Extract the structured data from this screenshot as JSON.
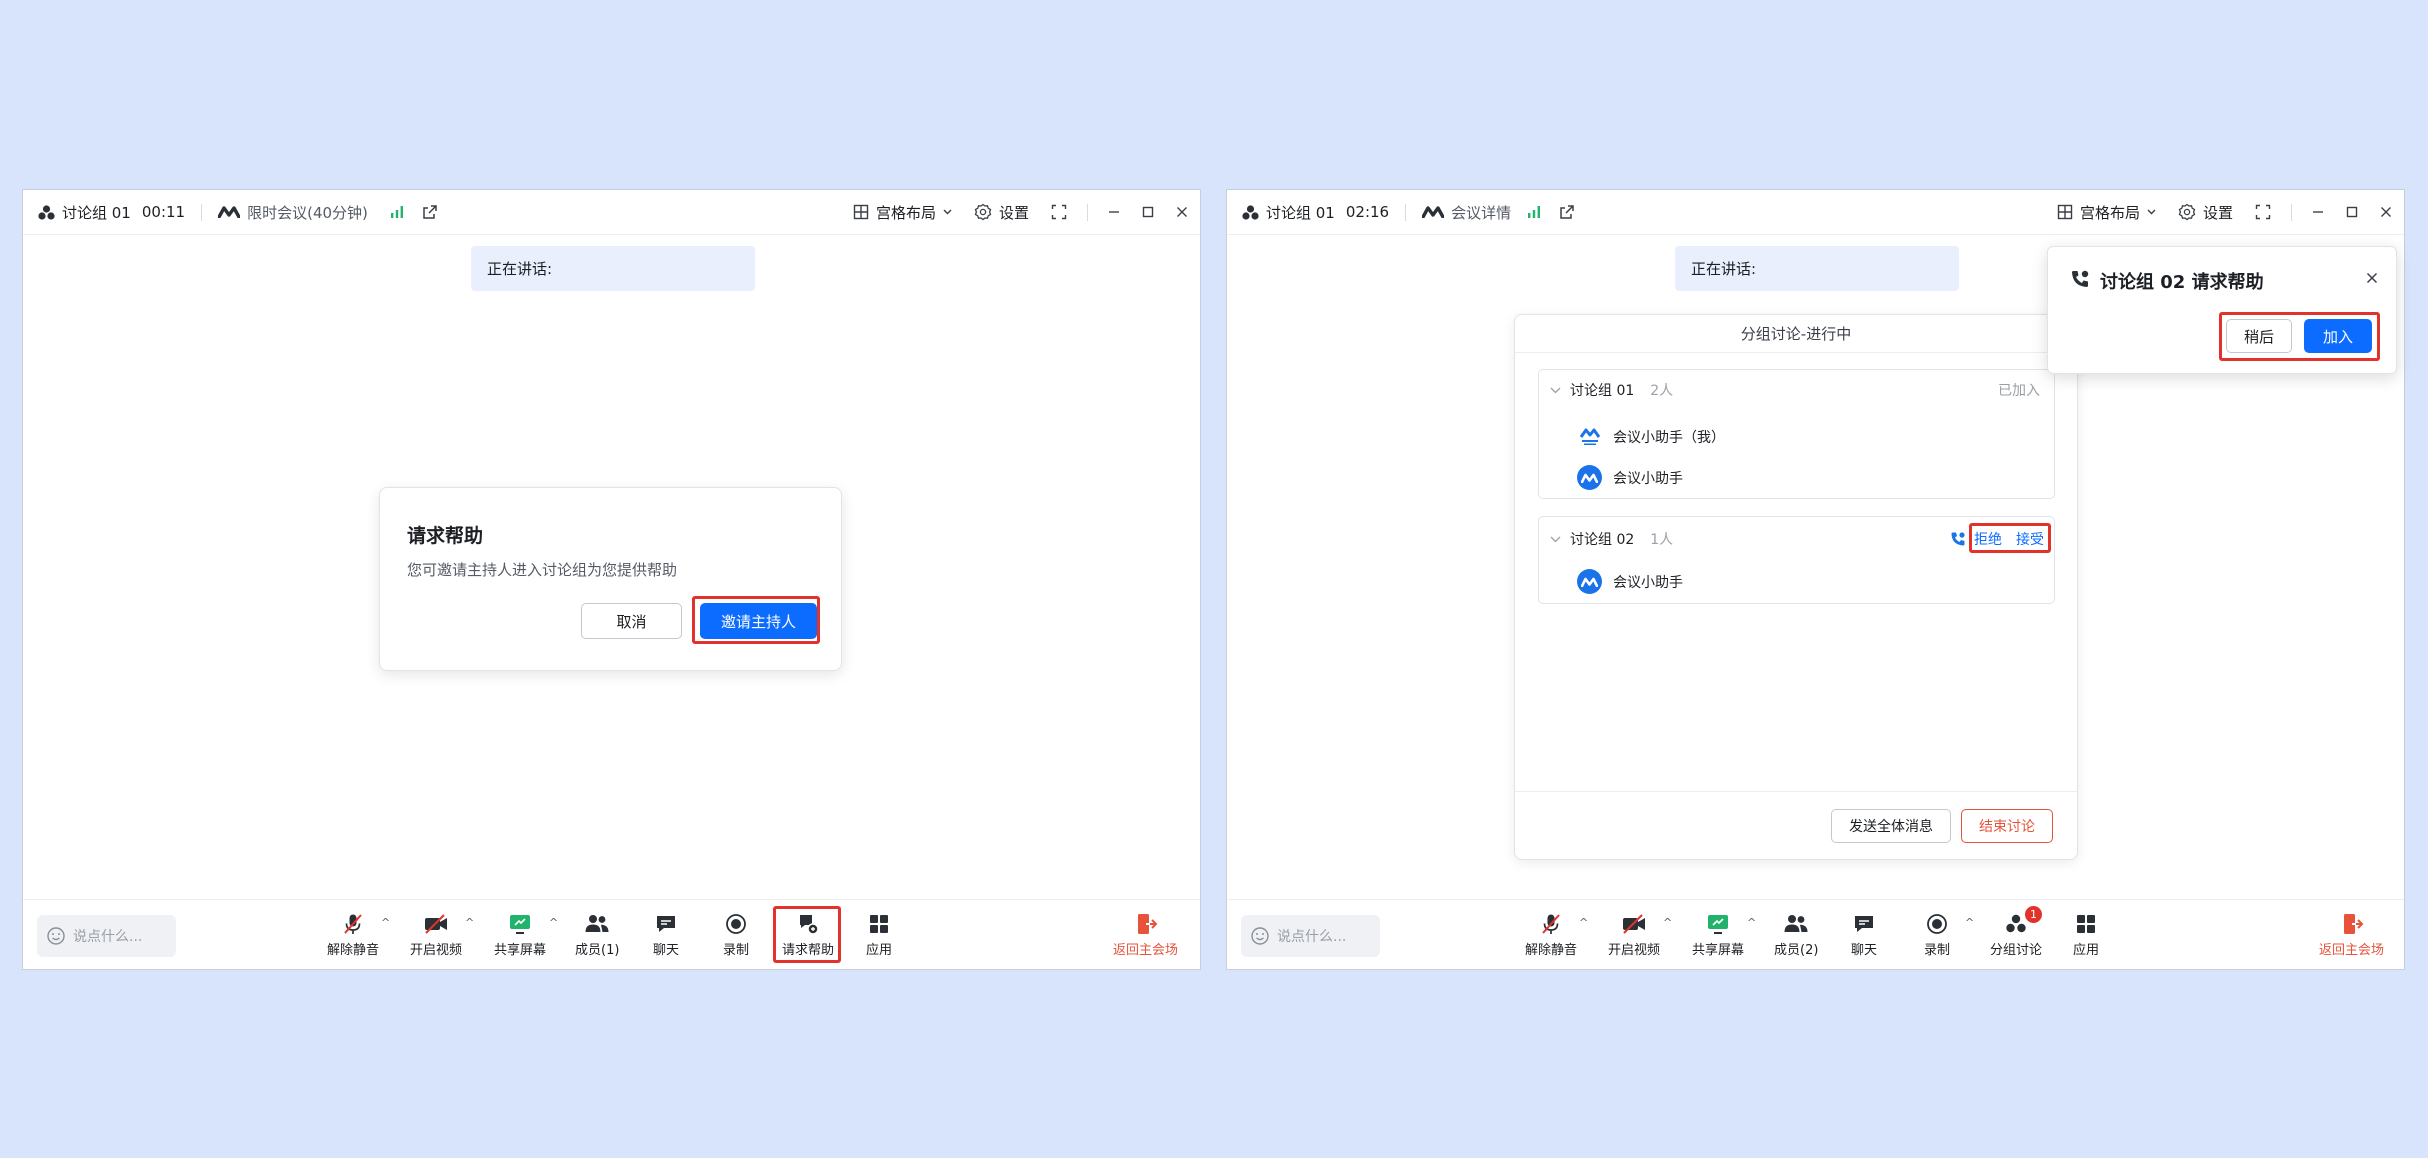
{
  "left_window": {
    "titlebar": {
      "group_name": "讨论组 01",
      "timer": "00:11",
      "meeting_info": "限时会议(40分钟)",
      "layout_label": "宫格布局",
      "settings_label": "设置"
    },
    "speaking_label": "正在讲话:",
    "dialog": {
      "title": "请求帮助",
      "text": "您可邀请主持人进入讨论组为您提供帮助",
      "cancel_label": "取消",
      "invite_label": "邀请主持人"
    },
    "toolbar": {
      "say_placeholder": "说点什么...",
      "unmute": "解除静音",
      "video": "开启视频",
      "share": "共享屏幕",
      "members": "成员(1)",
      "chat": "聊天",
      "record": "录制",
      "help": "请求帮助",
      "apps": "应用",
      "back": "返回主会场"
    }
  },
  "right_window": {
    "titlebar": {
      "group_name": "讨论组 01",
      "timer": "02:16",
      "meeting_info": "会议详情",
      "layout_label": "宫格布局",
      "settings_label": "设置"
    },
    "speaking_label": "正在讲话:",
    "breakout": {
      "header": "分组讨论-进行中",
      "groups": [
        {
          "name": "讨论组 01",
          "count": "2人",
          "status": "已加入",
          "members": [
            "会议小助手（我）",
            "会议小助手"
          ]
        },
        {
          "name": "讨论组 02",
          "count": "1人",
          "reject_label": "拒绝",
          "accept_label": "接受",
          "members": [
            "会议小助手"
          ]
        }
      ],
      "broadcast_label": "发送全体消息",
      "end_label": "结束讨论"
    },
    "notification": {
      "title": "讨论组 02 请求帮助",
      "later_label": "稍后",
      "join_label": "加入"
    },
    "toolbar": {
      "say_placeholder": "说点什么...",
      "unmute": "解除静音",
      "video": "开启视频",
      "share": "共享屏幕",
      "members": "成员(2)",
      "chat": "聊天",
      "record": "录制",
      "breakout": "分组讨论",
      "breakout_badge": "1",
      "apps": "应用",
      "back": "返回主会场"
    }
  },
  "colors": {
    "background": "#d8e4fb",
    "primary": "#0b6cff",
    "highlight_box": "#e1322b",
    "exit_red": "#e8523a",
    "signal_green": "#21b36b"
  }
}
